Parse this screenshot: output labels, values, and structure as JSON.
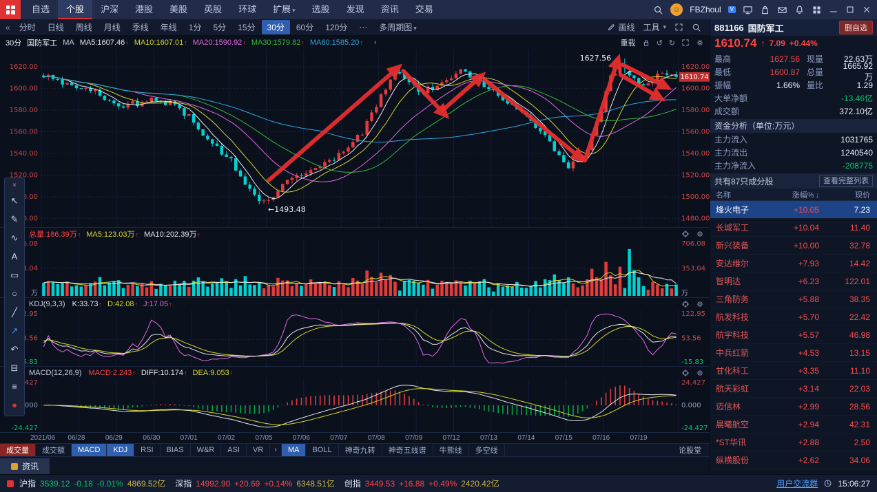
{
  "colors": {
    "up": "#e23c3c",
    "down": "#00d2d2",
    "accent": "#2f5fae",
    "red_text": "#ff4242",
    "green_text": "#00c568",
    "yellow_text": "#c8b43c",
    "link": "#4d9fff",
    "ma5": "#e8e8e8",
    "ma10": "#d6d62a",
    "ma20": "#e06ae0",
    "ma30": "#38b838",
    "ma60": "#2fa7e0",
    "annotation": "#e62e2e",
    "axis_red": "#c84848"
  },
  "ui": {
    "caret": "▾",
    "collapse_left": "«",
    "undo": "↺",
    "redo": "↻",
    "up_tick": "↑",
    "price_arrow": "↑",
    "smiley": "☺",
    "badge": "V"
  },
  "topbar": {
    "menu": [
      "自选",
      "个股",
      "沪深",
      "港股",
      "美股",
      "英股",
      "环球",
      "扩展",
      "选股",
      "发现",
      "资讯",
      "交易"
    ],
    "active": "个股",
    "user": "FBZhoul",
    "icons": [
      "screen-share-icon",
      "bag-icon",
      "mail-icon",
      "bell-icon",
      "apps-grid-icon"
    ],
    "window_buttons": [
      "minimize-icon",
      "maximize-icon",
      "close-icon"
    ]
  },
  "toolbar": {
    "periods": [
      "分时",
      "日线",
      "周线",
      "月线",
      "季线",
      "年线",
      "1分",
      "5分",
      "15分",
      "30分",
      "60分",
      "120分"
    ],
    "active_period": "30分",
    "more": "⋯",
    "multi_period": "多周期图",
    "draw_label": "画线",
    "tools_label": "工具"
  },
  "chart": {
    "title_period": "30分",
    "title_name": "国防军工",
    "overlay_label": "MA",
    "mas": [
      {
        "label": "MA5:1607.46",
        "color": "#e8e8e8"
      },
      {
        "label": "MA10:1607.01",
        "color": "#d6d62a"
      },
      {
        "label": "MA20:1590.92",
        "color": "#e06ae0"
      },
      {
        "label": "MA30:1579.82",
        "color": "#38b838"
      },
      {
        "label": "MA60:1585.20",
        "color": "#2fa7e0"
      }
    ],
    "collapse": "‹",
    "reload_label": "重载",
    "volume_values": [
      {
        "text": "总量:186.39万",
        "color": "#ff4242"
      },
      {
        "text": "MA5:123.03万",
        "color": "#d6d62a"
      },
      {
        "text": "MA10:202.39万",
        "color": "#e8e8e8"
      }
    ],
    "kdj_title": "KDJ(9,3,3)",
    "kdj_values": [
      {
        "text": "K:33.73",
        "color": "#e8e8e8"
      },
      {
        "text": "D:42.08",
        "color": "#d6d62a"
      },
      {
        "text": "J:17.05",
        "color": "#e06ae0"
      }
    ],
    "macd_title": "MACD(12,26,9)",
    "macd_values": [
      {
        "text": "MACD:2.243",
        "color": "#ff4242"
      },
      {
        "text": "DIFF:10.174",
        "color": "#e8e8e8"
      },
      {
        "text": "DEA:9.053",
        "color": "#d6d62a"
      }
    ],
    "price_ticks": [
      "1620.00",
      "1600.00",
      "1580.00",
      "1560.00",
      "1540.00",
      "1520.00",
      "1500.00",
      "1480.00"
    ],
    "volume_ticks": [
      "706.08",
      "353.04",
      "万"
    ],
    "kdj_ticks": [
      "122.95",
      "53.56",
      "-15.83"
    ],
    "macd_ticks": [
      "24.427",
      "0.000",
      "-24.427"
    ],
    "dates": [
      "2021/06",
      "06/28",
      "06/29",
      "06/30",
      "07/01",
      "07/02",
      "07/05",
      "07/06",
      "07/07",
      "07/08",
      "07/09",
      "07/12",
      "07/13",
      "07/14",
      "07/15",
      "07/16",
      "07/19"
    ],
    "high_label": "1627.56",
    "low_label": "←1493.48",
    "current_price_tag": "1610.74"
  },
  "chart_data": {
    "type": "candlestick",
    "bars": 136,
    "days": 17,
    "ylim": [
      1472,
      1636
    ],
    "price_anchors": [
      [
        0,
        1612
      ],
      [
        0.03,
        1606
      ],
      [
        0.059,
        1600
      ],
      [
        0.088,
        1596
      ],
      [
        0.118,
        1583
      ],
      [
        0.147,
        1586
      ],
      [
        0.176,
        1592
      ],
      [
        0.206,
        1584
      ],
      [
        0.235,
        1572
      ],
      [
        0.265,
        1549
      ],
      [
        0.294,
        1536
      ],
      [
        0.324,
        1508
      ],
      [
        0.347,
        1495
      ],
      [
        0.36,
        1498
      ],
      [
        0.382,
        1512
      ],
      [
        0.412,
        1521
      ],
      [
        0.441,
        1528
      ],
      [
        0.471,
        1542
      ],
      [
        0.5,
        1556
      ],
      [
        0.52,
        1578
      ],
      [
        0.545,
        1605
      ],
      [
        0.558,
        1616
      ],
      [
        0.575,
        1606
      ],
      [
        0.6,
        1597
      ],
      [
        0.62,
        1603
      ],
      [
        0.64,
        1610
      ],
      [
        0.655,
        1617
      ],
      [
        0.68,
        1610
      ],
      [
        0.7,
        1601
      ],
      [
        0.72,
        1592
      ],
      [
        0.75,
        1580
      ],
      [
        0.77,
        1570
      ],
      [
        0.79,
        1556
      ],
      [
        0.81,
        1543
      ],
      [
        0.83,
        1529
      ],
      [
        0.845,
        1532
      ],
      [
        0.86,
        1545
      ],
      [
        0.88,
        1576
      ],
      [
        0.895,
        1608
      ],
      [
        0.91,
        1622
      ],
      [
        0.925,
        1612
      ],
      [
        0.94,
        1607
      ],
      [
        0.955,
        1604
      ],
      [
        0.97,
        1611
      ],
      [
        0.985,
        1615
      ],
      [
        1,
        1610.74
      ]
    ],
    "high": 1627.56,
    "high_t": 0.915,
    "low": 1493.48,
    "low_t": 0.35,
    "last_close": 1610.74,
    "volume_max_wan": 706.08,
    "volume_total_wan": 186.39,
    "kdj": {
      "k": 33.73,
      "d": 42.08,
      "j": 17.05
    },
    "macd": {
      "macd": 2.243,
      "diff": 10.174,
      "dea": 9.053
    },
    "arrows": [
      [
        0.357,
        0.736,
        0.56,
        0.101
      ],
      [
        0.568,
        0.12,
        0.634,
        0.368
      ],
      [
        0.63,
        0.341,
        0.691,
        0.147
      ],
      [
        0.696,
        0.171,
        0.848,
        0.616
      ],
      [
        0.853,
        0.624,
        0.905,
        0.054
      ],
      [
        0.912,
        0.085,
        0.982,
        0.213
      ],
      [
        0.909,
        0.143,
        0.972,
        0.275
      ]
    ]
  },
  "draw_toolbar": [
    {
      "name": "close-icon",
      "glyph": "×",
      "style": "close"
    },
    {
      "name": "pointer-tool",
      "glyph": "↖"
    },
    {
      "name": "brush-tool",
      "glyph": "✎"
    },
    {
      "name": "curve-tool",
      "glyph": "∿"
    },
    {
      "name": "text-tool",
      "glyph": "A"
    },
    {
      "name": "rect-tool",
      "glyph": "▭"
    },
    {
      "name": "ellipse-tool",
      "glyph": "○"
    },
    {
      "name": "line-tool",
      "glyph": "╱"
    },
    {
      "name": "trend-arrow-tool",
      "glyph": "↗",
      "style": "blue"
    },
    {
      "name": "undo-tool",
      "glyph": "↶"
    },
    {
      "name": "eraser-tool",
      "glyph": "⊟"
    },
    {
      "name": "menu-tool",
      "glyph": "≡"
    },
    {
      "name": "record-tool",
      "glyph": "●",
      "style": "red"
    }
  ],
  "indicator_tabs": {
    "left": [
      {
        "label": "成交量",
        "state": "red"
      },
      {
        "label": "成交额"
      },
      {
        "label": "MACD",
        "state": "blue"
      },
      {
        "label": "KDJ",
        "state": "blue"
      },
      {
        "label": "RSI"
      },
      {
        "label": "BIAS"
      },
      {
        "label": "W&R"
      },
      {
        "label": "ASI"
      },
      {
        "label": "VR"
      }
    ],
    "arrow": "›",
    "right": [
      {
        "label": "MA",
        "state": "blue"
      },
      {
        "label": "BOLL"
      },
      {
        "label": "神奇九转"
      },
      {
        "label": "神奇五线谱"
      },
      {
        "label": "牛熊线"
      },
      {
        "label": "多空线"
      }
    ],
    "forum": "论股堂"
  },
  "news_tab": "资讯",
  "quote": {
    "code": "881166",
    "name": "国防军工",
    "remove_button": "删自选",
    "price": "1610.74",
    "change": "7.09",
    "change_pct": "+0.44%",
    "stats": [
      {
        "k": "最高",
        "v": "1627.56",
        "vc": "red",
        "k2": "现量",
        "v2": "22.63万",
        "v2c": "white"
      },
      {
        "k": "最低",
        "v": "1600.87",
        "vc": "red",
        "k2": "总量",
        "v2": "1665.92万",
        "v2c": "white"
      },
      {
        "k": "振幅",
        "v": "1.66%",
        "vc": "white",
        "k2": "量比",
        "v2": "1.29",
        "v2c": "white"
      }
    ],
    "big_net_label": "大单净额",
    "big_net": "-13.46亿",
    "turnover_label": "成交额",
    "turnover": "372.10亿",
    "funds_title": "资金分析（单位:万元）",
    "funds": [
      {
        "k": "主力流入",
        "v": "1031765",
        "c": "white"
      },
      {
        "k": "主力流出",
        "v": "1240540",
        "c": "white"
      },
      {
        "k": "主力净流入",
        "v": "-208775",
        "c": "green"
      }
    ],
    "constituents_title": "共有87只成分股",
    "view_all": "查看完整列表",
    "table_header": [
      "名称",
      "涨幅%",
      "现价"
    ],
    "sort_icon": "↓",
    "rows": [
      {
        "name": "烽火电子",
        "chg": "+10.05",
        "price": "7.23",
        "selected": true
      },
      {
        "name": "长城军工",
        "chg": "+10.04",
        "price": "11.40"
      },
      {
        "name": "新兴装备",
        "chg": "+10.00",
        "price": "32.78"
      },
      {
        "name": "安达维尔",
        "chg": "+7.93",
        "price": "14.42"
      },
      {
        "name": "智明达",
        "chg": "+6.23",
        "price": "122.01"
      },
      {
        "name": "三角防务",
        "chg": "+5.88",
        "price": "38.35"
      },
      {
        "name": "航发科技",
        "chg": "+5.70",
        "price": "22.42"
      },
      {
        "name": "航宇科技",
        "chg": "+5.57",
        "price": "46.98"
      },
      {
        "name": "中兵红箭",
        "chg": "+4.53",
        "price": "13.15"
      },
      {
        "name": "甘化科工",
        "chg": "+3.35",
        "price": "11.10"
      },
      {
        "name": "航天彩虹",
        "chg": "+3.14",
        "price": "22.03"
      },
      {
        "name": "迈信林",
        "chg": "+2.99",
        "price": "28.56"
      },
      {
        "name": "晨曦航空",
        "chg": "+2.94",
        "price": "42.31"
      },
      {
        "name": "*ST华讯",
        "chg": "+2.88",
        "price": "2.50"
      },
      {
        "name": "纵横股份",
        "chg": "+2.62",
        "price": "34.06"
      }
    ]
  },
  "statusbar": {
    "indices": [
      {
        "name": "沪指",
        "value": "3539.12",
        "chg": "-0.18",
        "pct": "-0.01%",
        "amt": "4869.52亿",
        "dir": "down"
      },
      {
        "name": "深指",
        "value": "14992.90",
        "chg": "+20.69",
        "pct": "+0.14%",
        "amt": "6348.51亿",
        "dir": "up"
      },
      {
        "name": "创指",
        "value": "3449.53",
        "chg": "+16.88",
        "pct": "+0.49%",
        "amt": "2420.42亿",
        "dir": "up"
      }
    ],
    "link": "用户交流群",
    "time": "15:06:27"
  }
}
